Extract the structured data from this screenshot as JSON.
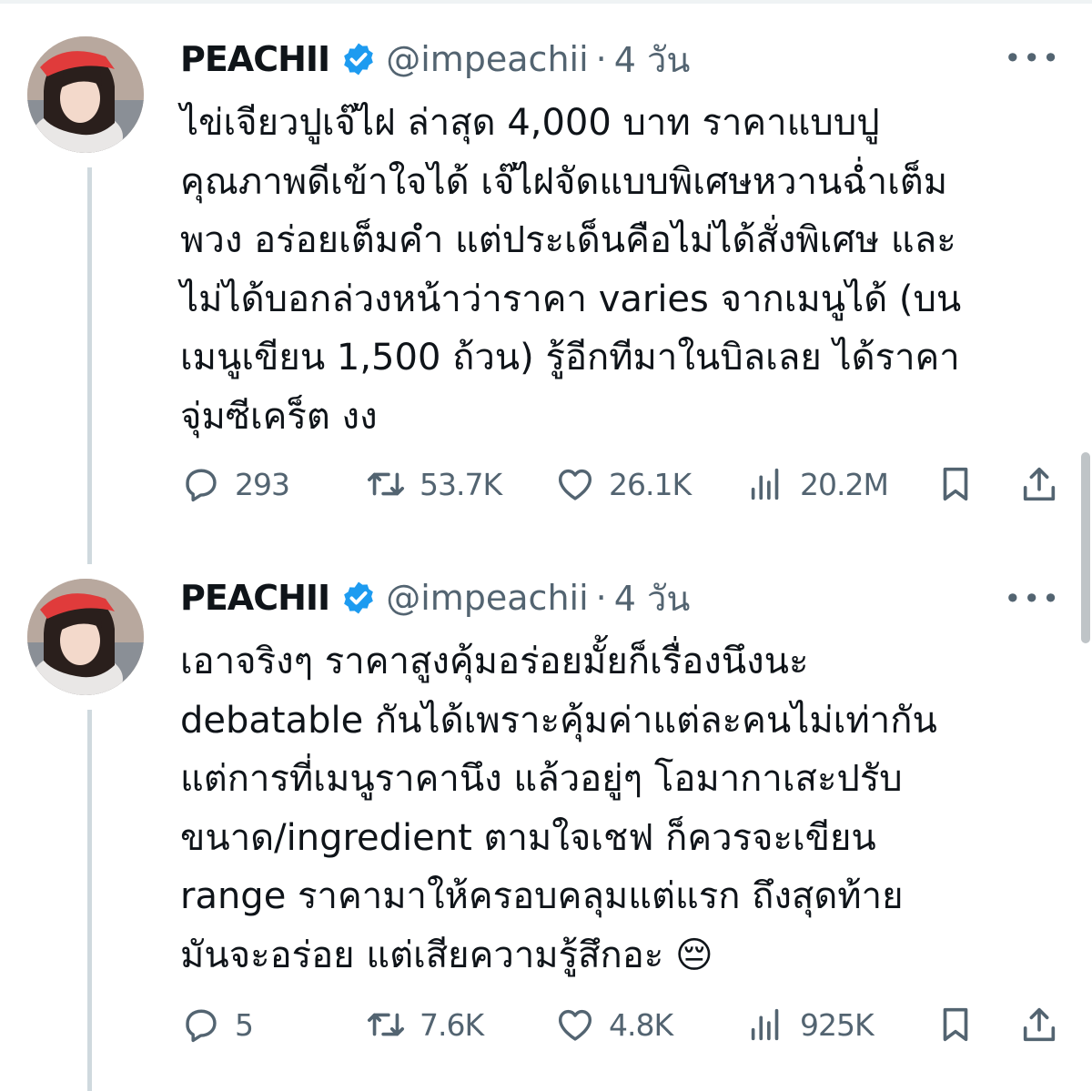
{
  "tweets": [
    {
      "author": {
        "display_name": "PEACHII",
        "handle": "@impeachii",
        "verified": true,
        "avatar_icon": "profile-photo"
      },
      "separator": "·",
      "time": "4 วัน",
      "more_icon": "more-horizontal-icon",
      "text": "ไข่เจียวปูเจ๊ไฝ ล่าสุด 4,000 บาท ราคาแบบปู\nคุณภาพดีเข้าใจได้ เจ๊ไฝจัดแบบพิเศษหวานฉ่ำเต็ม\nพวง อร่อยเต็มคำ แต่ประเด็นคือไม่ได้สั่งพิเศษ และ\nไม่ได้บอกล่วงหน้าว่าราคา varies จากเมนูได้ (บน\nเมนูเขียน 1,500 ถ้วน) รู้อีกทีมาในบิลเลย ได้ราคา\nจุ่มซีเคร็ต งง",
      "stats": {
        "replies": "293",
        "retweets": "53.7K",
        "likes": "26.1K",
        "views": "20.2M"
      }
    },
    {
      "author": {
        "display_name": "PEACHII",
        "handle": "@impeachii",
        "verified": true,
        "avatar_icon": "profile-photo"
      },
      "separator": "·",
      "time": "4 วัน",
      "more_icon": "more-horizontal-icon",
      "text": "เอาจริงๆ ราคาสูงคุ้มอร่อยมั้ยก็เรื่องนึงนะ\ndebatable กันได้เพราะคุ้มค่าแต่ละคนไม่เท่ากัน\nแต่การที่เมนูราคานึง แล้วอยู่ๆ โอมากาเสะปรับ\nขนาด/ingredient ตามใจเชฟ ก็ควรจะเขียน\nrange ราคามาให้ครอบคลุมแต่แรก ถึงสุดท้าย\nมันจะอร่อย แต่เสียความรู้สึกอะ 😔",
      "stats": {
        "replies": "5",
        "retweets": "7.6K",
        "likes": "4.8K",
        "views": "925K"
      }
    }
  ],
  "colors": {
    "text": "#0f1419",
    "secondary": "#536471",
    "verified": "#1d9bf0",
    "thread_line": "#cfd9de"
  }
}
